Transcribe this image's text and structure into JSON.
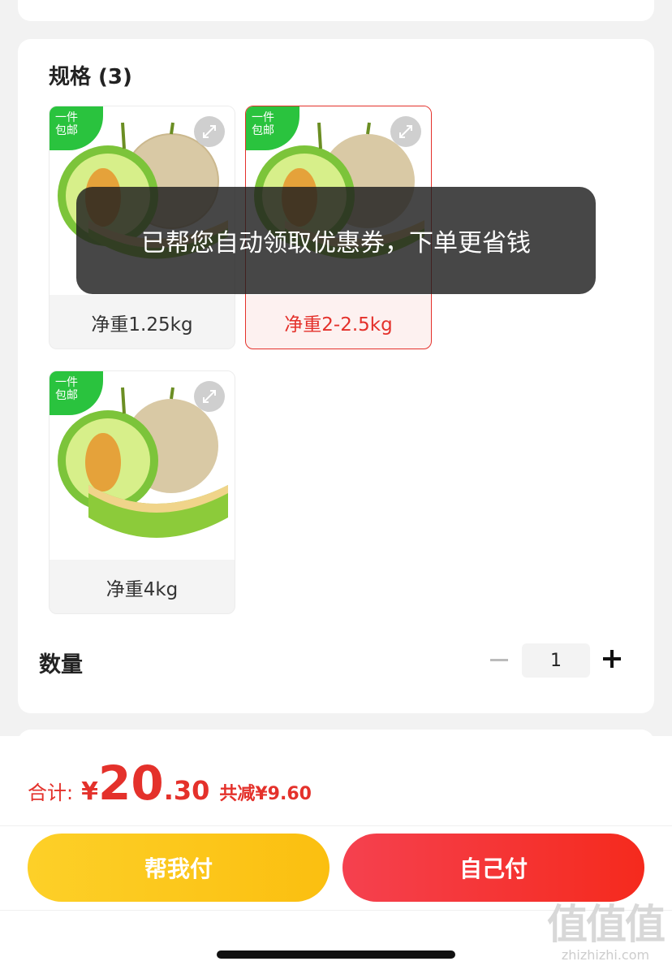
{
  "spec_section": {
    "title": "规格 (3)",
    "options": [
      {
        "label": "净重1.25kg",
        "badge": "一件\n包邮",
        "selected": false
      },
      {
        "label": "净重2-2.5kg",
        "badge": "一件\n包邮",
        "selected": true
      },
      {
        "label": "净重4kg",
        "badge": "一件\n包邮",
        "selected": false
      }
    ]
  },
  "quantity": {
    "label": "数量",
    "value": "1"
  },
  "toast": {
    "message": "已帮您自动领取优惠券，下单更省钱"
  },
  "summary": {
    "total_label": "合计:",
    "currency": "¥",
    "total_int": "20",
    "total_dec": ".30",
    "saved": "共减¥9.60"
  },
  "actions": {
    "help_pay": "帮我付",
    "self_pay": "自己付"
  },
  "watermark": {
    "logo": "值值值",
    "site": "zhizhizhi.com"
  },
  "colors": {
    "accent_red": "#e4312b",
    "badge_green": "#2ac33e",
    "help_yellow": "#fbbf10"
  }
}
